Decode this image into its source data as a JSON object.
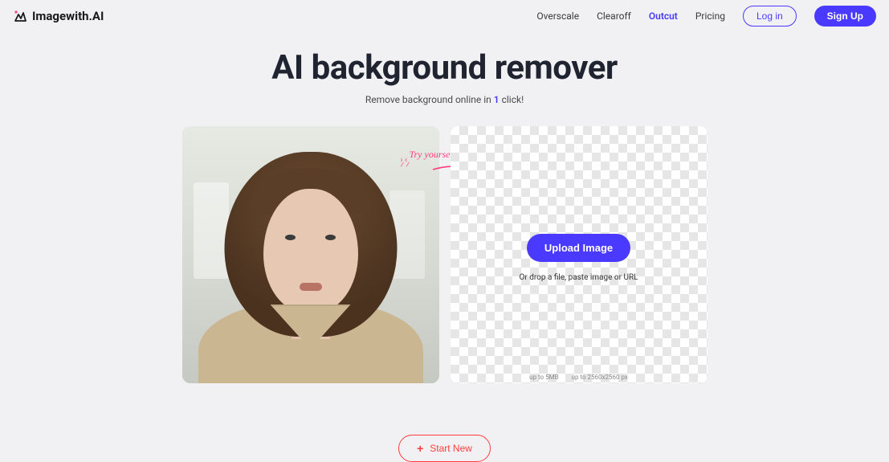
{
  "brand": {
    "name": "Imagewith.AI"
  },
  "nav": {
    "items": [
      {
        "label": "Overscale",
        "active": false
      },
      {
        "label": "Clearoff",
        "active": false
      },
      {
        "label": "Outcut",
        "active": true
      },
      {
        "label": "Pricing",
        "active": false
      }
    ],
    "login": "Log in",
    "signup": "Sign Up"
  },
  "hero": {
    "title": "AI background remover",
    "subtitle_pre": "Remove background online in ",
    "subtitle_accent": "1",
    "subtitle_post": " click!"
  },
  "callout": {
    "text": "Try yourself for free"
  },
  "dropzone": {
    "upload_label": "Upload Image",
    "hint": "Or drop a file, paste image or URL",
    "foot1": "up to 5MB",
    "foot2": "up to 2560x2560 px"
  },
  "actions": {
    "start_new": "Start New"
  },
  "colors": {
    "primary": "#4a3aff",
    "accent_pink": "#ff3c7e",
    "danger": "#ff3c3c"
  }
}
